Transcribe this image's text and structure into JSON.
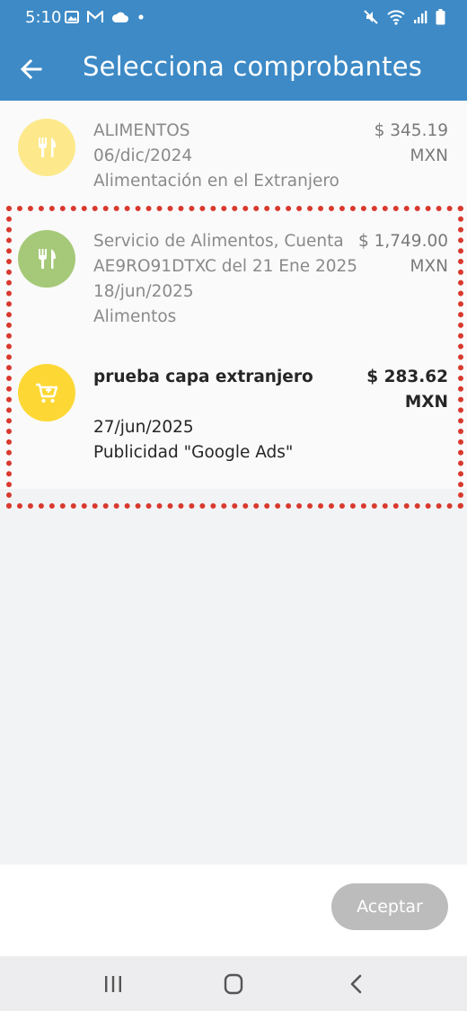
{
  "status_bar": {
    "time": "5:10",
    "left_icons": [
      "image-icon",
      "gmail-icon",
      "cloud-icon",
      "dot-icon"
    ],
    "right_icons": [
      "mute-icon",
      "wifi-icon",
      "signal-icon",
      "battery-icon"
    ]
  },
  "app_bar": {
    "title": "Selecciona comprobantes",
    "back_icon": "arrow-left-icon"
  },
  "receipts": [
    {
      "icon": "fork-knife-icon",
      "icon_bg": "#fde98c",
      "title_lines": [
        "ALIMENTOS"
      ],
      "date": "06/dic/2024",
      "category": "Alimentación en el Extranjero",
      "amount": "$ 345.19",
      "currency": "MXN"
    },
    {
      "icon": "fork-knife-icon",
      "icon_bg": "#a5c978",
      "title_lines": [
        "Servicio de Alimentos, Cuenta",
        "AE9RO91DTXC del 21 Ene 2025"
      ],
      "date": "18/jun/2025",
      "category": "Alimentos",
      "amount": "$ 1,749.00",
      "currency": "MXN"
    },
    {
      "icon": "cart-icon",
      "icon_bg": "#fdd835",
      "title_lines": [
        "prueba capa extranjero"
      ],
      "date": "27/jun/2025",
      "category": "Publicidad \"Google Ads\"",
      "amount": "$ 283.62",
      "currency": "MXN"
    }
  ],
  "footer": {
    "accept_label": "Aceptar"
  },
  "nav_bar": {
    "buttons": [
      "recents-icon",
      "home-icon",
      "back-icon"
    ]
  },
  "colors": {
    "primary": "#3d8ac6",
    "selection_border": "#d9392e",
    "disabled_button": "#bcbcbc"
  }
}
